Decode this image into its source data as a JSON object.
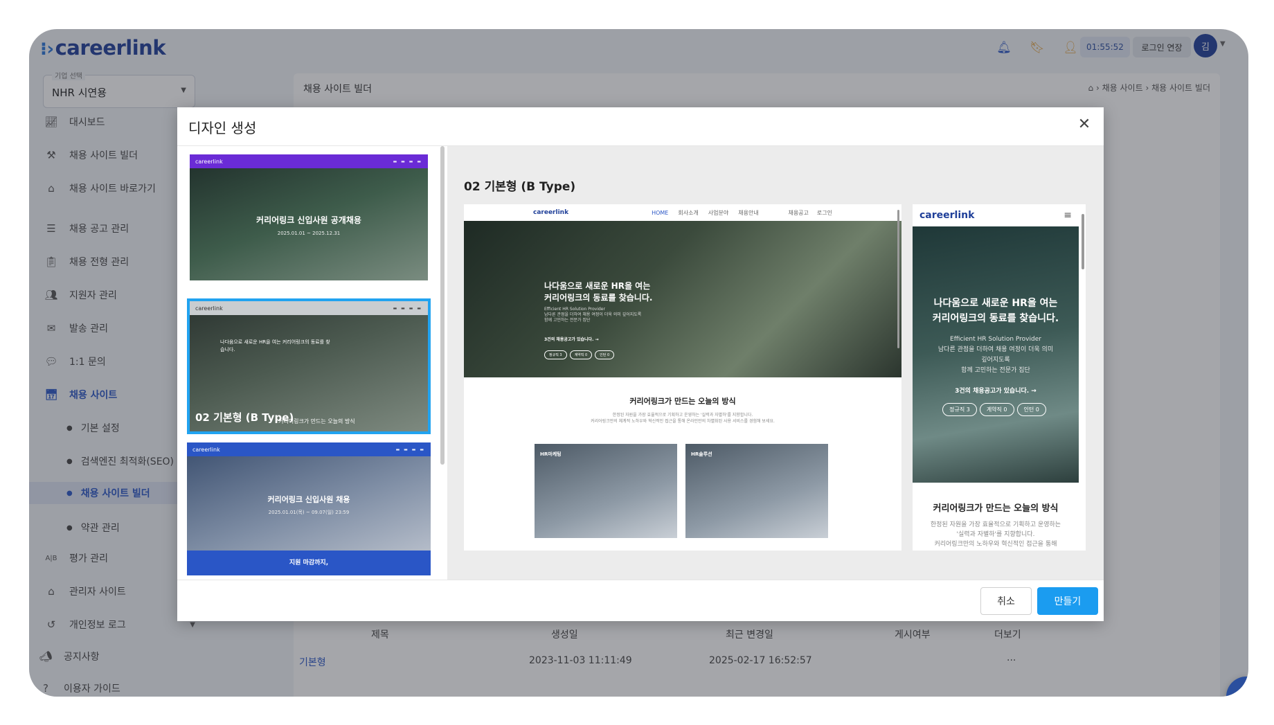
{
  "app": {
    "logo": "careerlink",
    "timer": "01:55:52",
    "extend_login": "로그인 연장",
    "avatar_initial": "김"
  },
  "sidebar": {
    "company_label": "기업 선택",
    "company_value": "NHR 시연용",
    "items": [
      {
        "label": "대시보드"
      },
      {
        "label": "채용 사이트 빌더"
      },
      {
        "label": "채용 사이트 바로가기"
      },
      {
        "label": "채용 공고 관리"
      },
      {
        "label": "채용 전형 관리"
      },
      {
        "label": "지원자 관리"
      },
      {
        "label": "발송 관리"
      },
      {
        "label": "1:1 문의"
      },
      {
        "label": "채용 사이트"
      },
      {
        "label": "평가 관리"
      },
      {
        "label": "관리자 사이트"
      },
      {
        "label": "개인정보 로그"
      },
      {
        "label": "공지사항"
      },
      {
        "label": "이용자 가이드"
      }
    ],
    "sub_items": [
      {
        "label": "기본 설정"
      },
      {
        "label": "검색엔진 최적화(SEO)"
      },
      {
        "label": "채용 사이트 빌더"
      },
      {
        "label": "약관 관리"
      }
    ]
  },
  "page": {
    "title": "채용 사이트 빌더",
    "breadcrumb": [
      "채용 사이트",
      "채용 사이트 빌더"
    ],
    "design_create_button": "디자인 생성",
    "search_placeholder": "제목",
    "table_headers": [
      "제목",
      "생성일",
      "최근 변경일",
      "게시여부",
      "더보기"
    ],
    "table_row": {
      "title": "기본형",
      "created": "2023-11-03 11:11:49",
      "updated": "2025-02-17 16:52:57",
      "more": "···"
    }
  },
  "modal": {
    "title": "디자인 생성",
    "thumbnails": [
      {
        "logo": "careerlink",
        "headline": "커리어링크 신입사원 공개채용",
        "sub": "2025.01.01 ~ 2025.12.31",
        "colors": {
          "nav": "#6a2bd6",
          "bg": "#3e5c4b"
        }
      },
      {
        "logo": "careerlink",
        "headline": "나다움으로 새로운 HR을 여는 커리어링크의 동료를 찾습니다.",
        "label": "02 기본형 (B Type)",
        "label2": "커리어링크가 만드는 오늘의 방식",
        "selected": true
      },
      {
        "logo": "careerlink",
        "headline": "커리어링크 신입사원 채용",
        "sub": "2025.01.01(목) ~ 09.07(일) 23:59",
        "footer": "지원 마감까지,",
        "colors": {
          "nav": "#2a56c6"
        }
      }
    ],
    "preview_title": "02 기본형 (B Type)",
    "desktop": {
      "logo": "careerlink",
      "nav_links": [
        "HOME",
        "회사소개",
        "사업분야",
        "채용안내"
      ],
      "nav_right": [
        "채용공고",
        "로그인"
      ],
      "hero_title": "나다움으로 새로운 HR을 여는\n커리어링크의 동료를 찾습니다.",
      "hero_sub": "Efficient HR Solution Provider\n남다른 관점을 더하여 채용 여정이 더욱 의미 깊어지도록\n함께 고민하는 전문가 집단",
      "hero_cta": "3건의 채용공고가 있습니다. →",
      "pills": [
        "정규직 3",
        "계약직 0",
        "인턴 0"
      ],
      "section_title": "커리어링크가 만드는 오늘의 방식",
      "section_sub": "한정된 자원을 가장 효율적으로 기획하고 운영하는 '실력과 자별하'를 지향합니다.\n커리어링크만의 체계적 노하우와 혁신적인 접근을 통해 온라인만의 차별화된 사용 서비스를 경험해 보세요.",
      "cards": [
        {
          "title": "HR마케팅"
        },
        {
          "title": "HR솔루션"
        }
      ]
    },
    "mobile": {
      "logo": "careerlink",
      "hero_title": "나다움으로 새로운 HR을 여는\n커리어링크의 동료를 찾습니다.",
      "hero_sub": "Efficient HR Solution Provider\n남다른 관점을 더하여 채용 여정이 더욱 의미\n깊어지도록\n함께 고민하는 전문가 집단",
      "hero_cta": "3건의 채용공고가 있습니다. →",
      "pills": [
        "정규직 3",
        "계약직 0",
        "인턴 0"
      ],
      "section_title": "커리어링크가 만드는 오늘의 방식",
      "section_sub": "한정된 자원을 가장 효율적으로 기획하고 운영하는\n'실력과 자별하'를 지향합니다.\n커리어링크만의 노하우와 혁신적인 접근을 통해"
    },
    "cancel_label": "취소",
    "create_label": "만들기"
  },
  "colors": {
    "primary": "#1b9cf0",
    "brand": "#1f3f99",
    "selected_outline": "#21a3f0"
  }
}
